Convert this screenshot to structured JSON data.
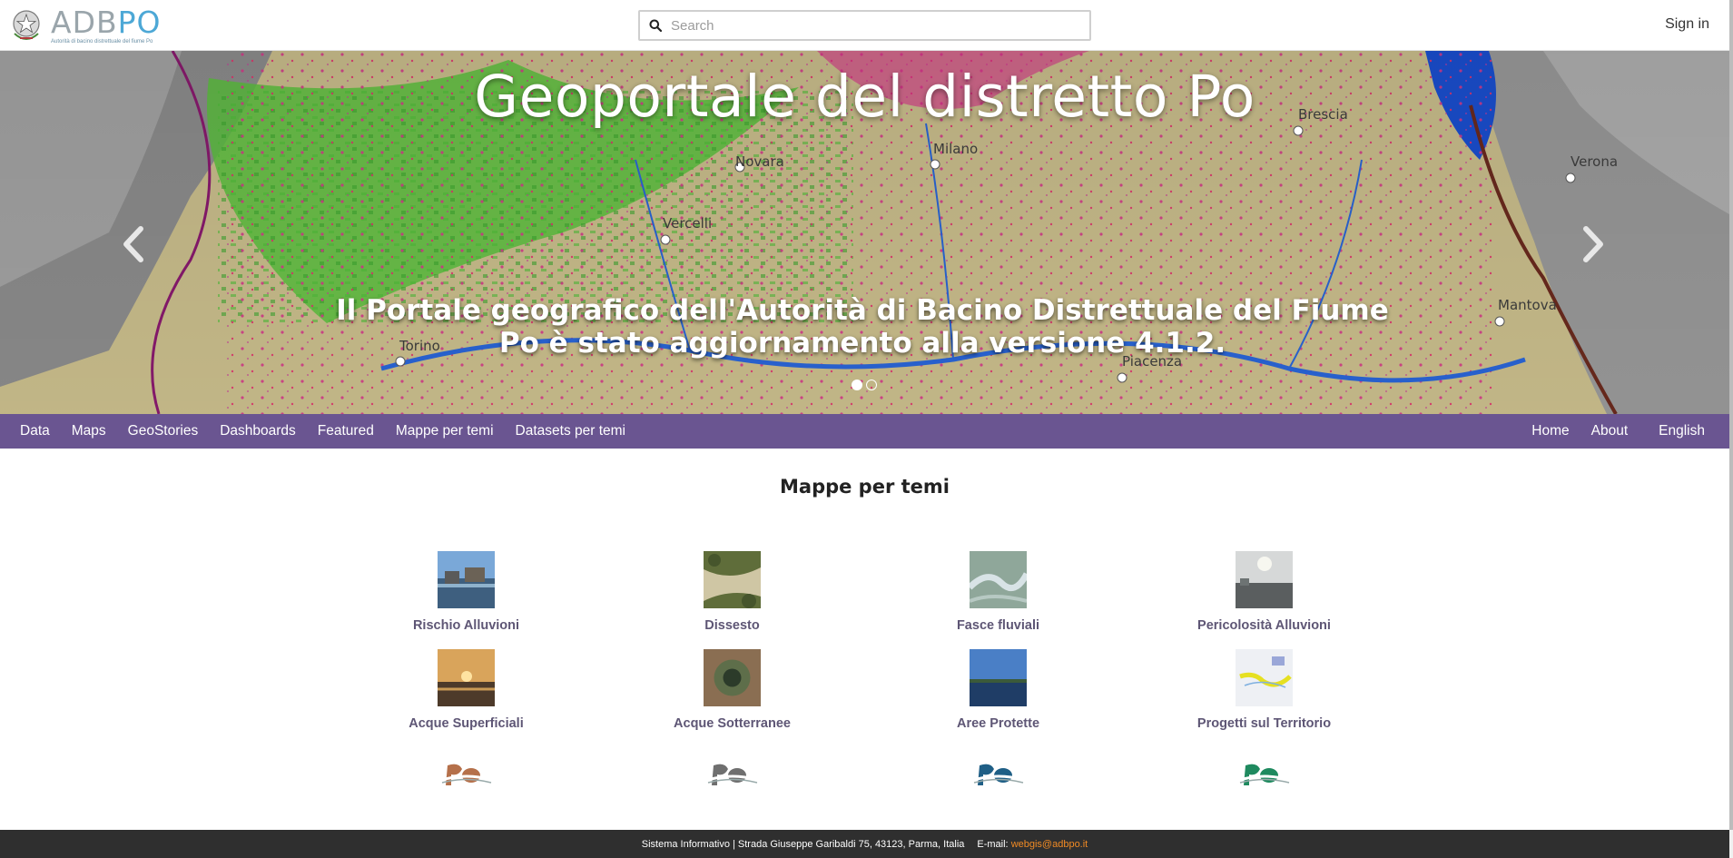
{
  "header": {
    "logo": {
      "title": "ADBPO",
      "subtitle": "Autorità di bacino distrettuale del fiume Po"
    },
    "search": {
      "placeholder": "Search",
      "value": ""
    },
    "signin_label": "Sign in"
  },
  "hero": {
    "title": "Geoportale del distretto Po",
    "caption": "Il Portale geografico dell'Autorità di Bacino Distrettuale del Fiume Po è stato aggiornamento alla versione 4.1.2.",
    "map_labels": [
      "Novara",
      "Milano",
      "Brescia",
      "Verona",
      "Vercelli",
      "Torino",
      "Mantova",
      "Piacenza"
    ],
    "slides_total": 2,
    "active_slide": 1
  },
  "nav": {
    "left": [
      "Data",
      "Maps",
      "GeoStories",
      "Dashboards",
      "Featured",
      "Mappe per temi",
      "Datasets per temi"
    ],
    "right": [
      "Home",
      "About",
      "English"
    ]
  },
  "main": {
    "title": "Mappe per temi",
    "cards": [
      {
        "label": "Rischio Alluvioni",
        "image": "flood-photo"
      },
      {
        "label": "Dissesto",
        "image": "landslide-photo"
      },
      {
        "label": "Fasce fluviali",
        "image": "river-aerial-photo"
      },
      {
        "label": "Pericolosità Alluvioni",
        "image": "flood-hazard-photo"
      },
      {
        "label": "Acque Superficiali",
        "image": "sunset-river-photo"
      },
      {
        "label": "Acque Sotterranee",
        "image": "well-photo"
      },
      {
        "label": "Aree Protette",
        "image": "lake-photo"
      },
      {
        "label": "Progetti sul Territorio",
        "image": "map-thumbnail"
      }
    ],
    "po_logos": [
      {
        "color": "#b5704a"
      },
      {
        "color": "#6f6f6f"
      },
      {
        "color": "#1f5f86"
      },
      {
        "color": "#1f8a5f"
      }
    ]
  },
  "footer": {
    "text": "Sistema Informativo | Strada Giuseppe Garibaldi 75, 43123, Parma, Italia",
    "email_label": "E-mail:",
    "email": "webgis@adbpo.it"
  }
}
